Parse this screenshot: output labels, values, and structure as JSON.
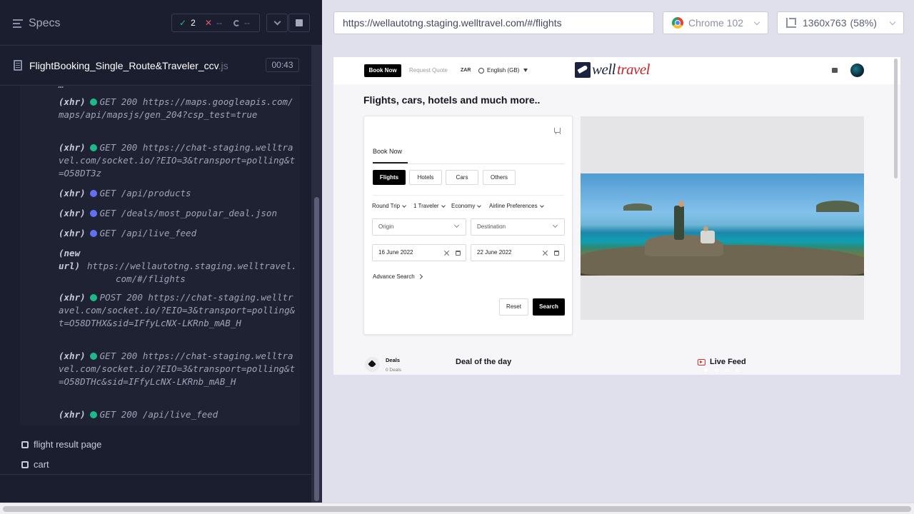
{
  "runner": {
    "specs_label": "Specs",
    "stats": {
      "passed": "2",
      "failed": "--",
      "pending": "--"
    },
    "spec": {
      "name": "FlightBooking_Single_Route&Traveler_ccv",
      "ext": ".js",
      "duration": "00:43"
    },
    "log": [
      {
        "kind": "(xhr)",
        "status_color": "#1fb889",
        "text": "GET 200 https://maps.googleapis.com/maps/api/mapsjs/gen_204?csp_test=true"
      },
      {
        "kind": "(xhr)",
        "status_color": "#1fb889",
        "text": "GET 200 https://chat-staging.welltravel.com/socket.io/?EIO=3&transport=polling&t=O58DT3z"
      },
      {
        "kind": "(xhr)",
        "status_color": "#6470f3",
        "text": "GET /api/products"
      },
      {
        "kind": "(xhr)",
        "status_color": "#6470f3",
        "text": "GET /deals/most_popular_deal.json"
      },
      {
        "kind": "(xhr)",
        "status_color": "#6470f3",
        "text": "GET /api/live_feed"
      },
      {
        "kind": "(new url)",
        "text": "https://wellautotng.staging.welltravel.com/#/flights"
      },
      {
        "kind": "(xhr)",
        "status_color": "#1fb889",
        "text": "POST 200 https://chat-staging.welltravel.com/socket.io/?EIO=3&transport=polling&t=O58DTHX&sid=IFfyLcNX-LKRnb_mAB_H"
      },
      {
        "kind": "(xhr)",
        "status_color": "#1fb889",
        "text": "GET 200 https://chat-staging.welltravel.com/socket.io/?EIO=3&transport=polling&t=O58DTHc&sid=IFfyLcNX-LKRnb_mAB_H"
      },
      {
        "kind": "(xhr)",
        "status_color": "#1fb889",
        "text": "GET 200 /api/live_feed"
      }
    ],
    "steps": [
      "flight result page",
      "cart"
    ]
  },
  "browser": {
    "url": "https://wellautotng.staging.welltravel.com/#/flights",
    "browser_name": "Chrome 102",
    "viewport": "1360x763",
    "zoom": "(58%)"
  },
  "app": {
    "topbar": {
      "book_now": "Book Now",
      "request_quote": "Request Quote",
      "currency": "ZAR",
      "language": "English (GB)",
      "logo_main": "well",
      "logo_accent": "travel"
    },
    "headline": "Flights, cars, hotels and much more..",
    "booking": {
      "tab": "Book Now",
      "products": [
        "Flights",
        "Hotels",
        "Cars",
        "Others"
      ],
      "active_product": "Flights",
      "options": [
        "Round Trip",
        "1 Traveler",
        "Economy",
        "Airline Preferences"
      ],
      "origin_placeholder": "Origin",
      "destination_placeholder": "Destination",
      "depart_date": "16 June 2022",
      "return_date": "22 June 2022",
      "advance_search": "Advance Search",
      "reset_label": "Reset",
      "search_label": "Search"
    },
    "carousel": {
      "slides": 4,
      "active": 1
    },
    "deals": {
      "title": "Deals",
      "count": "0 Deals"
    },
    "deal_of_day": "Deal of the day",
    "live_feed": "Live Feed"
  }
}
